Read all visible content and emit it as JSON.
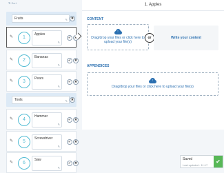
{
  "left": {
    "top_link": "⇅ Sort",
    "sections": [
      {
        "title": "Fruits",
        "items": [
          {
            "number": "1",
            "name": "Apples"
          },
          {
            "number": "2",
            "name": "Bananas"
          },
          {
            "number": "3",
            "name": "Pears"
          }
        ]
      },
      {
        "title": "Tools",
        "items": [
          {
            "number": "4",
            "name": "Hammer"
          },
          {
            "number": "5",
            "name": "Screwdriver"
          },
          {
            "number": "6",
            "name": "Saw"
          }
        ]
      }
    ]
  },
  "panel": {
    "title": "1.  Apples",
    "content_label": "CONTENT",
    "drop_text": "Drag/drop your files or click here to upload your file(s)",
    "or_label": "or",
    "write_label": "Write your content",
    "appendices_label": "APPENDICES",
    "appendices_drop_text": "Drag/drop your files or click here to upload your file(s)"
  },
  "toast": {
    "title": "Saved",
    "subtitle": "Last updated : 11:17",
    "check": "✔"
  },
  "icons": {
    "grip": "✎",
    "pencil": "✎",
    "ok": "✔",
    "delete": "✖"
  }
}
